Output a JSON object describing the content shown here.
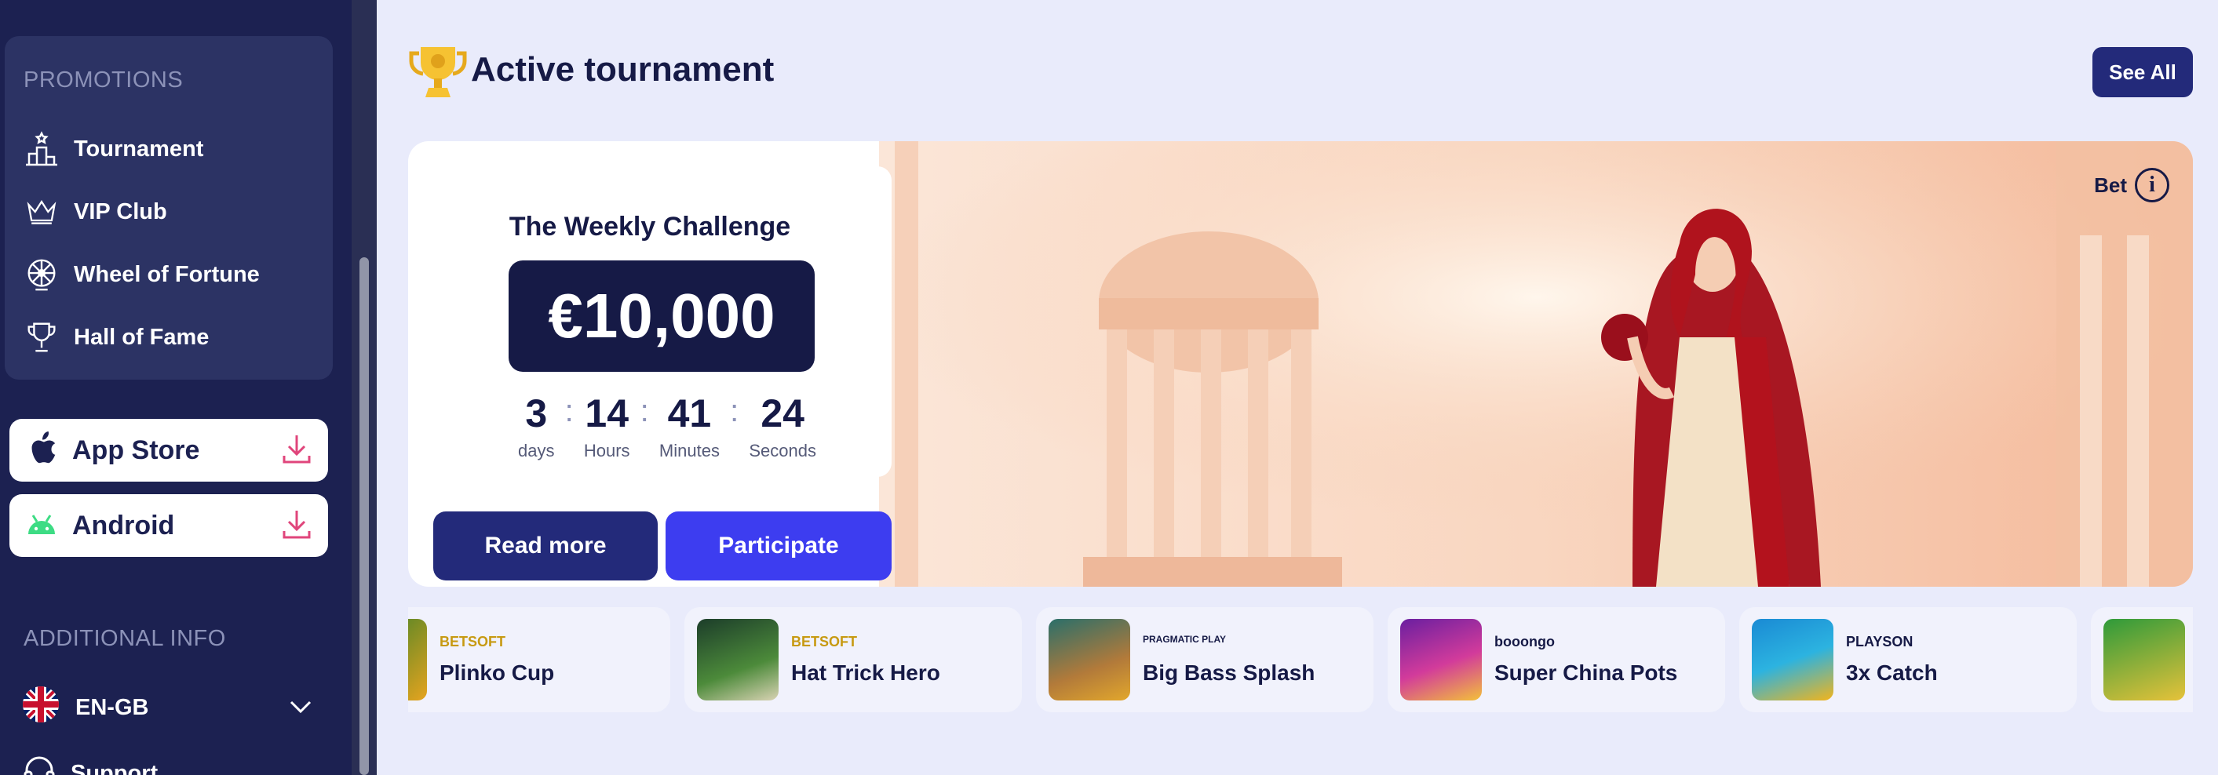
{
  "sidebar": {
    "promotions_title": "PROMOTIONS",
    "items": [
      {
        "label": "Tournament",
        "icon": "podium-icon"
      },
      {
        "label": "VIP Club",
        "icon": "crown-icon"
      },
      {
        "label": "Wheel of Fortune",
        "icon": "wheel-icon"
      },
      {
        "label": "Hall of Fame",
        "icon": "trophy-outline-icon"
      }
    ],
    "app_store_label": "App Store",
    "android_label": "Android",
    "additional_title": "ADDITIONAL INFO",
    "language": "EN-GB",
    "support": "Support"
  },
  "header": {
    "title": "Active tournament",
    "see_all": "See All"
  },
  "tournament": {
    "name": "The Weekly Challenge",
    "prize": "€10,000",
    "countdown": [
      {
        "value": "3",
        "label": "days"
      },
      {
        "value": "14",
        "label": "Hours"
      },
      {
        "value": "41",
        "label": "Minutes"
      },
      {
        "value": "24",
        "label": "Seconds"
      }
    ],
    "read_more": "Read more",
    "participate": "Participate",
    "bet_label": "Bet"
  },
  "games": [
    {
      "name": "Plinko Cup",
      "provider": "BETSOFT"
    },
    {
      "name": "Hat Trick Hero",
      "provider": "BETSOFT"
    },
    {
      "name": "Big Bass Splash",
      "provider": "PRAGMATIC PLAY"
    },
    {
      "name": "Super China Pots",
      "provider": "booongo"
    },
    {
      "name": "3x Catch",
      "provider": "PLAYSON"
    },
    {
      "name": "",
      "provider": ""
    }
  ],
  "colors": {
    "sidebar_bg": "#1c2151",
    "accent_dark": "#232a7a",
    "accent_bright": "#3d3df0",
    "page_bg": "#e9ebfb"
  }
}
